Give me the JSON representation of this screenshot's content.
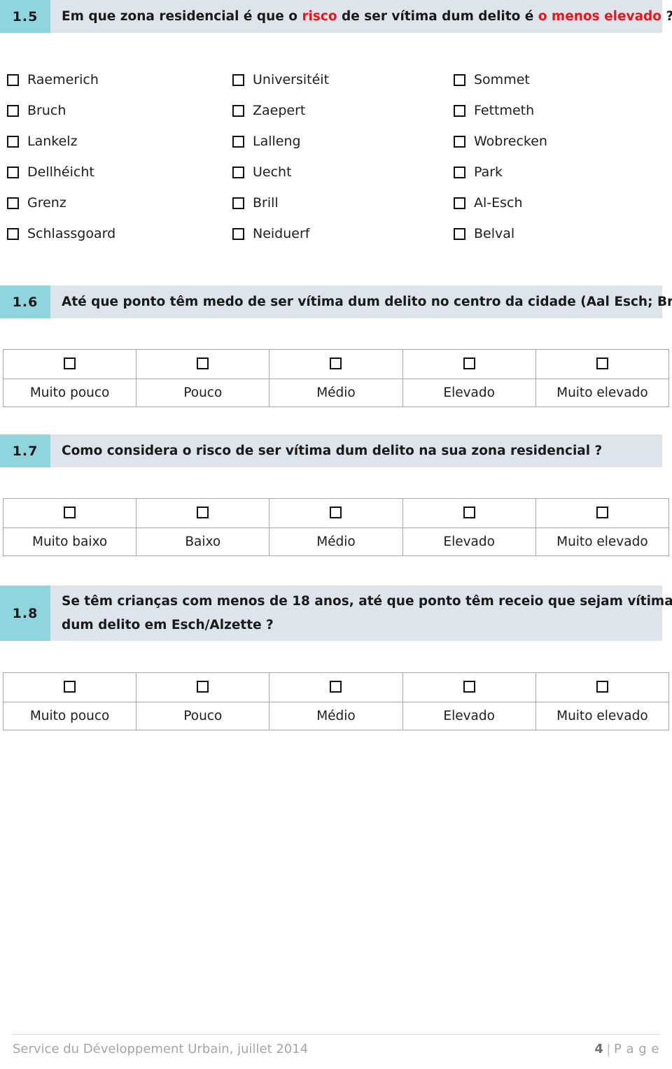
{
  "document": {
    "page_number": "4",
    "page_word": "P a g e",
    "footer_left": "Service du Développement Urbain,  juillet 2014",
    "footer_separator": "|"
  },
  "questions": [
    {
      "number": "1.5",
      "lines": [
        [
          {
            "text": "Em que zona residencial é que o ",
            "highlight": false
          },
          {
            "text": "risco",
            "highlight": true
          },
          {
            "text": " de ser vítima dum delito é ",
            "highlight": false
          },
          {
            "text": "o menos elevado",
            "highlight": true
          },
          {
            "text": " ?",
            "highlight": false
          }
        ]
      ]
    },
    {
      "number": "1.6",
      "lines": [
        [
          {
            "text": "Até que ponto têm medo de ser vítima dum delito no centro da cidade (Aal Esch; Brill) ?",
            "highlight": false
          }
        ]
      ]
    },
    {
      "number": "1.7",
      "lines": [
        [
          {
            "text": "Como considera o risco de ser vítima dum delito na sua zona residencial ?",
            "highlight": false
          }
        ]
      ]
    },
    {
      "number": "1.8",
      "lines": [
        [
          {
            "text": "Se têm crianças com menos de 18 anos, até que ponto têm receio que sejam vítimas",
            "highlight": false
          }
        ],
        [
          {
            "text": "dum delito em Esch/Alzette ?",
            "highlight": false
          }
        ]
      ]
    }
  ],
  "zone_options": {
    "column_1": [
      "Raemerich",
      "Bruch",
      "Lankelz",
      "Dellhéicht",
      "Grenz",
      "Schlassgoard"
    ],
    "column_2": [
      "Universitéit",
      "Zaepert",
      "Lalleng",
      "Uecht",
      "Brill",
      "Neiduerf"
    ],
    "column_3": [
      "Sommet",
      "Fettmeth",
      "Wobrecken",
      "Park",
      "Al-Esch",
      "Belval"
    ]
  },
  "scales": {
    "q16": [
      "Muito pouco",
      "Pouco",
      "Médio",
      "Elevado",
      "Muito elevado"
    ],
    "q17": [
      "Muito baixo",
      "Baixo",
      "Médio",
      "Elevado",
      "Muito elevado"
    ],
    "q18": [
      "Muito pouco",
      "Pouco",
      "Médio",
      "Elevado",
      "Muito elevado"
    ]
  },
  "colors": {
    "number_cell": "#8ed5de",
    "question_bar": "#dde4ec",
    "highlight_text": "#e8151b",
    "table_border": "#a6a6a6",
    "footer_text": "#a5a5a5"
  }
}
